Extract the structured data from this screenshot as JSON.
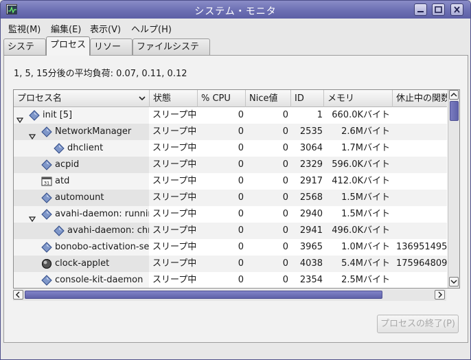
{
  "window": {
    "title": "システム・モニタ",
    "app_icon": "system-monitor-icon",
    "controls": [
      "minimize-icon",
      "maximize-icon",
      "close-icon"
    ]
  },
  "menubar": {
    "items": [
      {
        "label": "監視(M)"
      },
      {
        "label": "編集(E)"
      },
      {
        "label": "表示(V)"
      },
      {
        "label": "ヘルプ(H)"
      }
    ]
  },
  "tabs": [
    {
      "label": "システム",
      "active": false
    },
    {
      "label": "プロセス",
      "active": true
    },
    {
      "label": "リソース",
      "active": false
    },
    {
      "label": "ファイルシステム",
      "active": false
    }
  ],
  "load_average": "1, 5, 15分後の平均負荷: 0.07, 0.11, 0.12",
  "table": {
    "columns": [
      "プロセス名",
      "状態",
      "% CPU",
      "Nice値",
      "ID",
      "メモリ",
      "休止中の関数"
    ],
    "sort_indicator": "chevron-down-icon",
    "rows": [
      {
        "name": "init [5]",
        "depth": 0,
        "expander": "expanded",
        "icon": "diamond-process-icon",
        "status": "スリープ中",
        "cpu": "0",
        "nice": "0",
        "pid": "1",
        "memory": "660.0Kバイト",
        "wchan": ""
      },
      {
        "name": "NetworkManager",
        "depth": 1,
        "expander": "expanded",
        "icon": "diamond-process-icon",
        "status": "スリープ中",
        "cpu": "0",
        "nice": "0",
        "pid": "2535",
        "memory": "2.6Mバイト",
        "wchan": ""
      },
      {
        "name": "dhclient",
        "depth": 2,
        "expander": "none",
        "icon": "diamond-process-icon",
        "status": "スリープ中",
        "cpu": "0",
        "nice": "0",
        "pid": "3064",
        "memory": "1.7Mバイト",
        "wchan": ""
      },
      {
        "name": "acpid",
        "depth": 1,
        "expander": "none",
        "icon": "diamond-process-icon",
        "status": "スリープ中",
        "cpu": "0",
        "nice": "0",
        "pid": "2329",
        "memory": "596.0Kバイト",
        "wchan": ""
      },
      {
        "name": "atd",
        "depth": 1,
        "expander": "none",
        "icon": "calendar-icon",
        "status": "スリープ中",
        "cpu": "0",
        "nice": "0",
        "pid": "2917",
        "memory": "412.0Kバイト",
        "wchan": ""
      },
      {
        "name": "automount",
        "depth": 1,
        "expander": "none",
        "icon": "diamond-process-icon",
        "status": "スリープ中",
        "cpu": "0",
        "nice": "0",
        "pid": "2568",
        "memory": "1.5Mバイト",
        "wchan": ""
      },
      {
        "name": "avahi-daemon: running",
        "depth": 1,
        "expander": "expanded",
        "icon": "diamond-process-icon",
        "status": "スリープ中",
        "cpu": "0",
        "nice": "0",
        "pid": "2940",
        "memory": "1.5Mバイト",
        "wchan": ""
      },
      {
        "name": "avahi-daemon: chro",
        "depth": 2,
        "expander": "none",
        "icon": "diamond-process-icon",
        "status": "スリープ中",
        "cpu": "0",
        "nice": "0",
        "pid": "2941",
        "memory": "496.0Kバイト",
        "wchan": ""
      },
      {
        "name": "bonobo-activation-ser",
        "depth": 1,
        "expander": "none",
        "icon": "diamond-process-icon",
        "status": "スリープ中",
        "cpu": "0",
        "nice": "0",
        "pid": "3965",
        "memory": "1.0Mバイト",
        "wchan": "136951495"
      },
      {
        "name": "clock-applet",
        "depth": 1,
        "expander": "none",
        "icon": "clock-icon",
        "status": "スリープ中",
        "cpu": "0",
        "nice": "0",
        "pid": "4038",
        "memory": "5.4Mバイト",
        "wchan": "175964809"
      },
      {
        "name": "console-kit-daemon",
        "depth": 1,
        "expander": "none",
        "icon": "diamond-process-icon",
        "status": "スリープ中",
        "cpu": "0",
        "nice": "0",
        "pid": "2354",
        "memory": "2.5Mバイト",
        "wchan": ""
      }
    ]
  },
  "scrollbars": {
    "vertical": [
      "scroll-up-arrow-icon",
      "scroll-down-arrow-icon"
    ],
    "horizontal": [
      "scroll-left-arrow-icon",
      "scroll-right-arrow-icon"
    ]
  },
  "end_process_button": {
    "label": "プロセスの終了(P)",
    "enabled": false
  }
}
